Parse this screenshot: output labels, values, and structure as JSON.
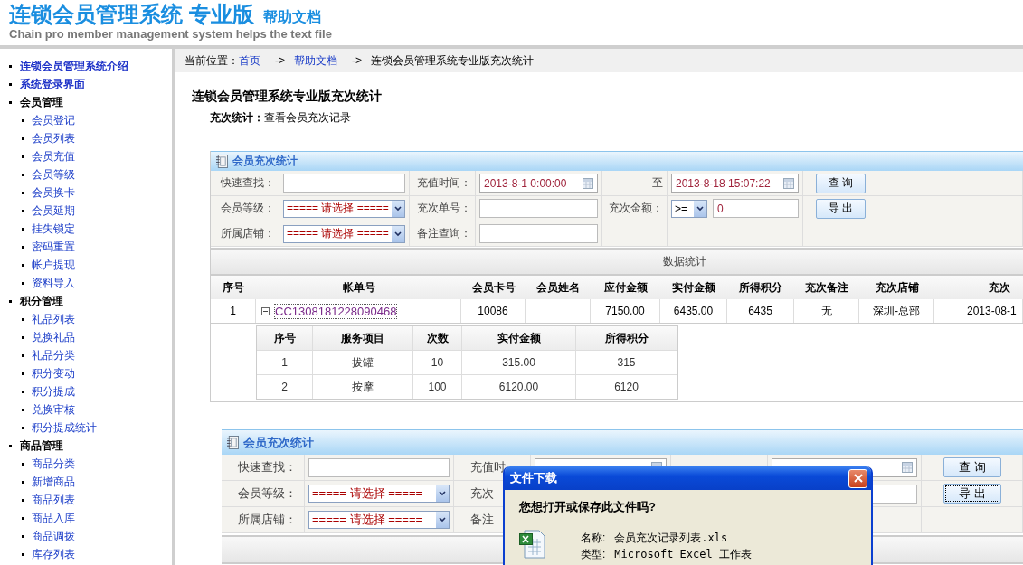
{
  "header": {
    "title": "连锁会员管理系统 专业版",
    "subtitle": "帮助文档",
    "tagline": "Chain pro member management system helps the text file"
  },
  "sidebar": {
    "items": [
      {
        "label": "连锁会员管理系统介绍",
        "kind": "link"
      },
      {
        "label": "系统登录界面",
        "kind": "link"
      },
      {
        "label": "会员管理",
        "kind": "section",
        "children": [
          {
            "label": "会员登记"
          },
          {
            "label": "会员列表"
          },
          {
            "label": "会员充值"
          },
          {
            "label": "会员等级"
          },
          {
            "label": "会员换卡"
          },
          {
            "label": "会员延期"
          },
          {
            "label": "挂失锁定"
          },
          {
            "label": "密码重置"
          },
          {
            "label": "帐户提现"
          },
          {
            "label": "资料导入"
          }
        ]
      },
      {
        "label": "积分管理",
        "kind": "section",
        "children": [
          {
            "label": "礼品列表"
          },
          {
            "label": "兑换礼品"
          },
          {
            "label": "礼品分类"
          },
          {
            "label": "积分变动"
          },
          {
            "label": "积分提成"
          },
          {
            "label": "兑换审核"
          },
          {
            "label": "积分提成统计"
          }
        ]
      },
      {
        "label": "商品管理",
        "kind": "section",
        "children": [
          {
            "label": "商品分类"
          },
          {
            "label": "新增商品"
          },
          {
            "label": "商品列表"
          },
          {
            "label": "商品入库"
          },
          {
            "label": "商品调拨"
          },
          {
            "label": "库存列表"
          }
        ]
      }
    ]
  },
  "breadcrumb": [
    {
      "text": "当前位置：",
      "kind": "label"
    },
    {
      "text": "首页",
      "kind": "link"
    },
    {
      "text": "->",
      "kind": "sep"
    },
    {
      "text": "帮助文档",
      "kind": "link"
    },
    {
      "text": "->",
      "kind": "sep"
    },
    {
      "text": "连锁会员管理系统专业版充次统计",
      "kind": "current"
    }
  ],
  "article": {
    "title": "连锁会员管理系统专业版充次统计",
    "intro": "**充次统计：**查看会员充次记录"
  },
  "screenshots": [
    {
      "title": "会员充次统计",
      "form": [
        [
          {
            "kind": "label",
            "text": "快速查找："
          },
          {
            "kind": "input"
          },
          {
            "kind": "label",
            "text": "充值时间："
          },
          {
            "kind": "date",
            "value": "2013-8-1 0:00:00"
          },
          {
            "kind": "label",
            "text": "至"
          },
          {
            "kind": "date",
            "value": "2013-8-18 15:07:22"
          },
          {
            "kind": "button",
            "text": "查 询",
            "focused": false
          }
        ],
        [
          {
            "kind": "label",
            "text": "会员等级："
          },
          {
            "kind": "select",
            "value": "===== 请选择 ====="
          },
          {
            "kind": "label",
            "text": "充次单号："
          },
          {
            "kind": "input"
          },
          {
            "kind": "label",
            "text": "充次金额："
          },
          {
            "kind": "compare",
            "op": ">=",
            "value": "0"
          },
          {
            "kind": "button",
            "text": "导 出",
            "focused": false
          }
        ],
        [
          {
            "kind": "label",
            "text": "所属店铺："
          },
          {
            "kind": "select",
            "value": "===== 请选择 ====="
          },
          {
            "kind": "label",
            "text": "备注查询："
          },
          {
            "kind": "input"
          },
          {
            "kind": "blank"
          },
          {
            "kind": "blank"
          },
          {
            "kind": "blank"
          }
        ]
      ],
      "stats_label": "数据统计",
      "table": {
        "columns": [
          "序号",
          "帐单号",
          "会员卡号",
          "会员姓名",
          "应付金额",
          "实付金额",
          "所得积分",
          "充次备注",
          "充次店铺",
          "充次"
        ],
        "rows": [
          {
            "cells": [
              "1",
              "CC1308181228090468",
              "10086",
              "",
              "7150.00",
              "6435.00",
              "6435",
              "无",
              "深圳-总部",
              "2013-08-1"
            ],
            "expanded": true,
            "detail": {
              "columns": [
                "序号",
                "服务项目",
                "次数",
                "实付金额",
                "所得积分"
              ],
              "rows": [
                [
                  "1",
                  "拔罐",
                  "10",
                  "315.00",
                  "315"
                ],
                [
                  "2",
                  "按摩",
                  "100",
                  "6120.00",
                  "6120"
                ]
              ]
            }
          }
        ]
      }
    },
    {
      "title": "会员充次统计",
      "form": [
        [
          {
            "kind": "label",
            "text": "快速查找："
          },
          {
            "kind": "input"
          },
          {
            "kind": "label",
            "text": "充值时"
          },
          {
            "kind": "date"
          },
          {
            "kind": "blank"
          },
          {
            "kind": "date"
          },
          {
            "kind": "button",
            "text": "查 询",
            "focused": false
          }
        ],
        [
          {
            "kind": "label",
            "text": "会员等级："
          },
          {
            "kind": "select",
            "value": "===== 请选择 ====="
          },
          {
            "kind": "label",
            "text": "充次"
          },
          {
            "kind": "blank"
          },
          {
            "kind": "blank"
          },
          {
            "kind": "input"
          },
          {
            "kind": "button",
            "text": "导 出",
            "focused": true
          }
        ],
        [
          {
            "kind": "label",
            "text": "所属店铺："
          },
          {
            "kind": "select",
            "value": "===== 请选择 ====="
          },
          {
            "kind": "label",
            "text": "备注"
          },
          {
            "kind": "blank"
          },
          {
            "kind": "blank"
          },
          {
            "kind": "blank"
          },
          {
            "kind": "blank"
          }
        ]
      ],
      "dialog": {
        "title": "文件下载",
        "question": "您想打开或保存此文件吗?",
        "fields": [
          {
            "label": "名称:",
            "value": "会员充次记录列表.xls"
          },
          {
            "label": "类型:",
            "value": "Microsoft Excel 工作表"
          }
        ]
      }
    }
  ]
}
